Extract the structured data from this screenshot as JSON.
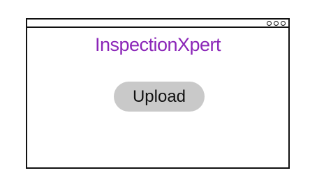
{
  "window": {
    "controls": [
      "window-control-dot",
      "window-control-dot",
      "window-control-dot"
    ]
  },
  "brand": {
    "logo_text": "InspectionXpert",
    "logo_color": "#8b26b8"
  },
  "main": {
    "upload_label": "Upload",
    "button_color": "#c9c9c9"
  }
}
